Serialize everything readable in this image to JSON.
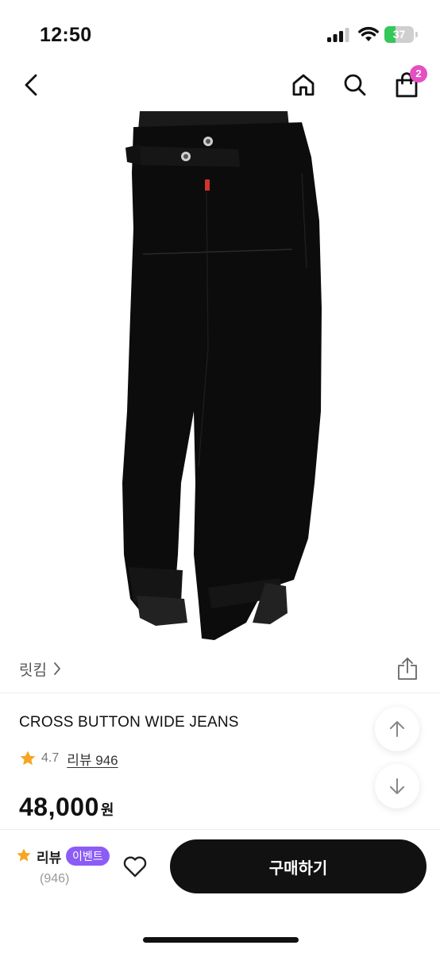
{
  "status_bar": {
    "time": "12:50",
    "battery_level": "37",
    "battery_fraction": 0.37,
    "icons": [
      "cellular-signal-icon",
      "wifi-icon",
      "battery-icon"
    ]
  },
  "nav": {
    "icons": [
      "back-arrow-icon",
      "home-icon",
      "search-icon",
      "shopping-bag-icon"
    ],
    "cart_count": "2"
  },
  "product": {
    "brand": "릿킴",
    "title": "CROSS BUTTON WIDE JEANS",
    "rating": "4.7",
    "review_link": "리뷰 946",
    "price": "48,000",
    "price_unit": "원"
  },
  "bottom_bar": {
    "review_label": "리뷰",
    "event_badge": "이벤트",
    "review_count": "(946)",
    "buy_label": "구매하기"
  },
  "colors": {
    "accent_badge": "#e64fc4",
    "event_badge": "#8b5cf6",
    "star": "#f5a623",
    "buy_button": "#111111"
  }
}
